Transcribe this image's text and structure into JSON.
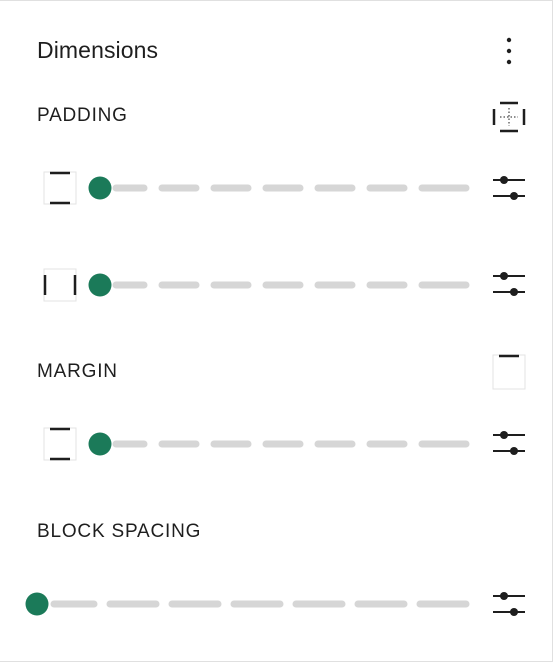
{
  "panel": {
    "title": "Dimensions",
    "menu_icon": "vertical-ellipsis-icon"
  },
  "padding": {
    "label": "PADDING",
    "link_icon": "unlink-sides-icon",
    "rows": [
      {
        "side": "vertical",
        "icon": "vertical-sides-icon",
        "value_fraction": 0,
        "options_icon": "settings-sliders-icon"
      },
      {
        "side": "horizontal",
        "icon": "horizontal-sides-icon",
        "value_fraction": 0,
        "options_icon": "settings-sliders-icon"
      }
    ]
  },
  "margin": {
    "label": "MARGIN",
    "link_icon": "link-sides-icon",
    "rows": [
      {
        "side": "vertical",
        "icon": "vertical-sides-icon",
        "value_fraction": 0,
        "options_icon": "settings-sliders-icon"
      }
    ]
  },
  "block_spacing": {
    "label": "BLOCK SPACING",
    "rows": [
      {
        "value_fraction": 0,
        "options_icon": "settings-sliders-icon"
      }
    ]
  },
  "colors": {
    "accent": "#1b7a59",
    "track": "#d6d6d6",
    "text": "#1e1e1e"
  }
}
